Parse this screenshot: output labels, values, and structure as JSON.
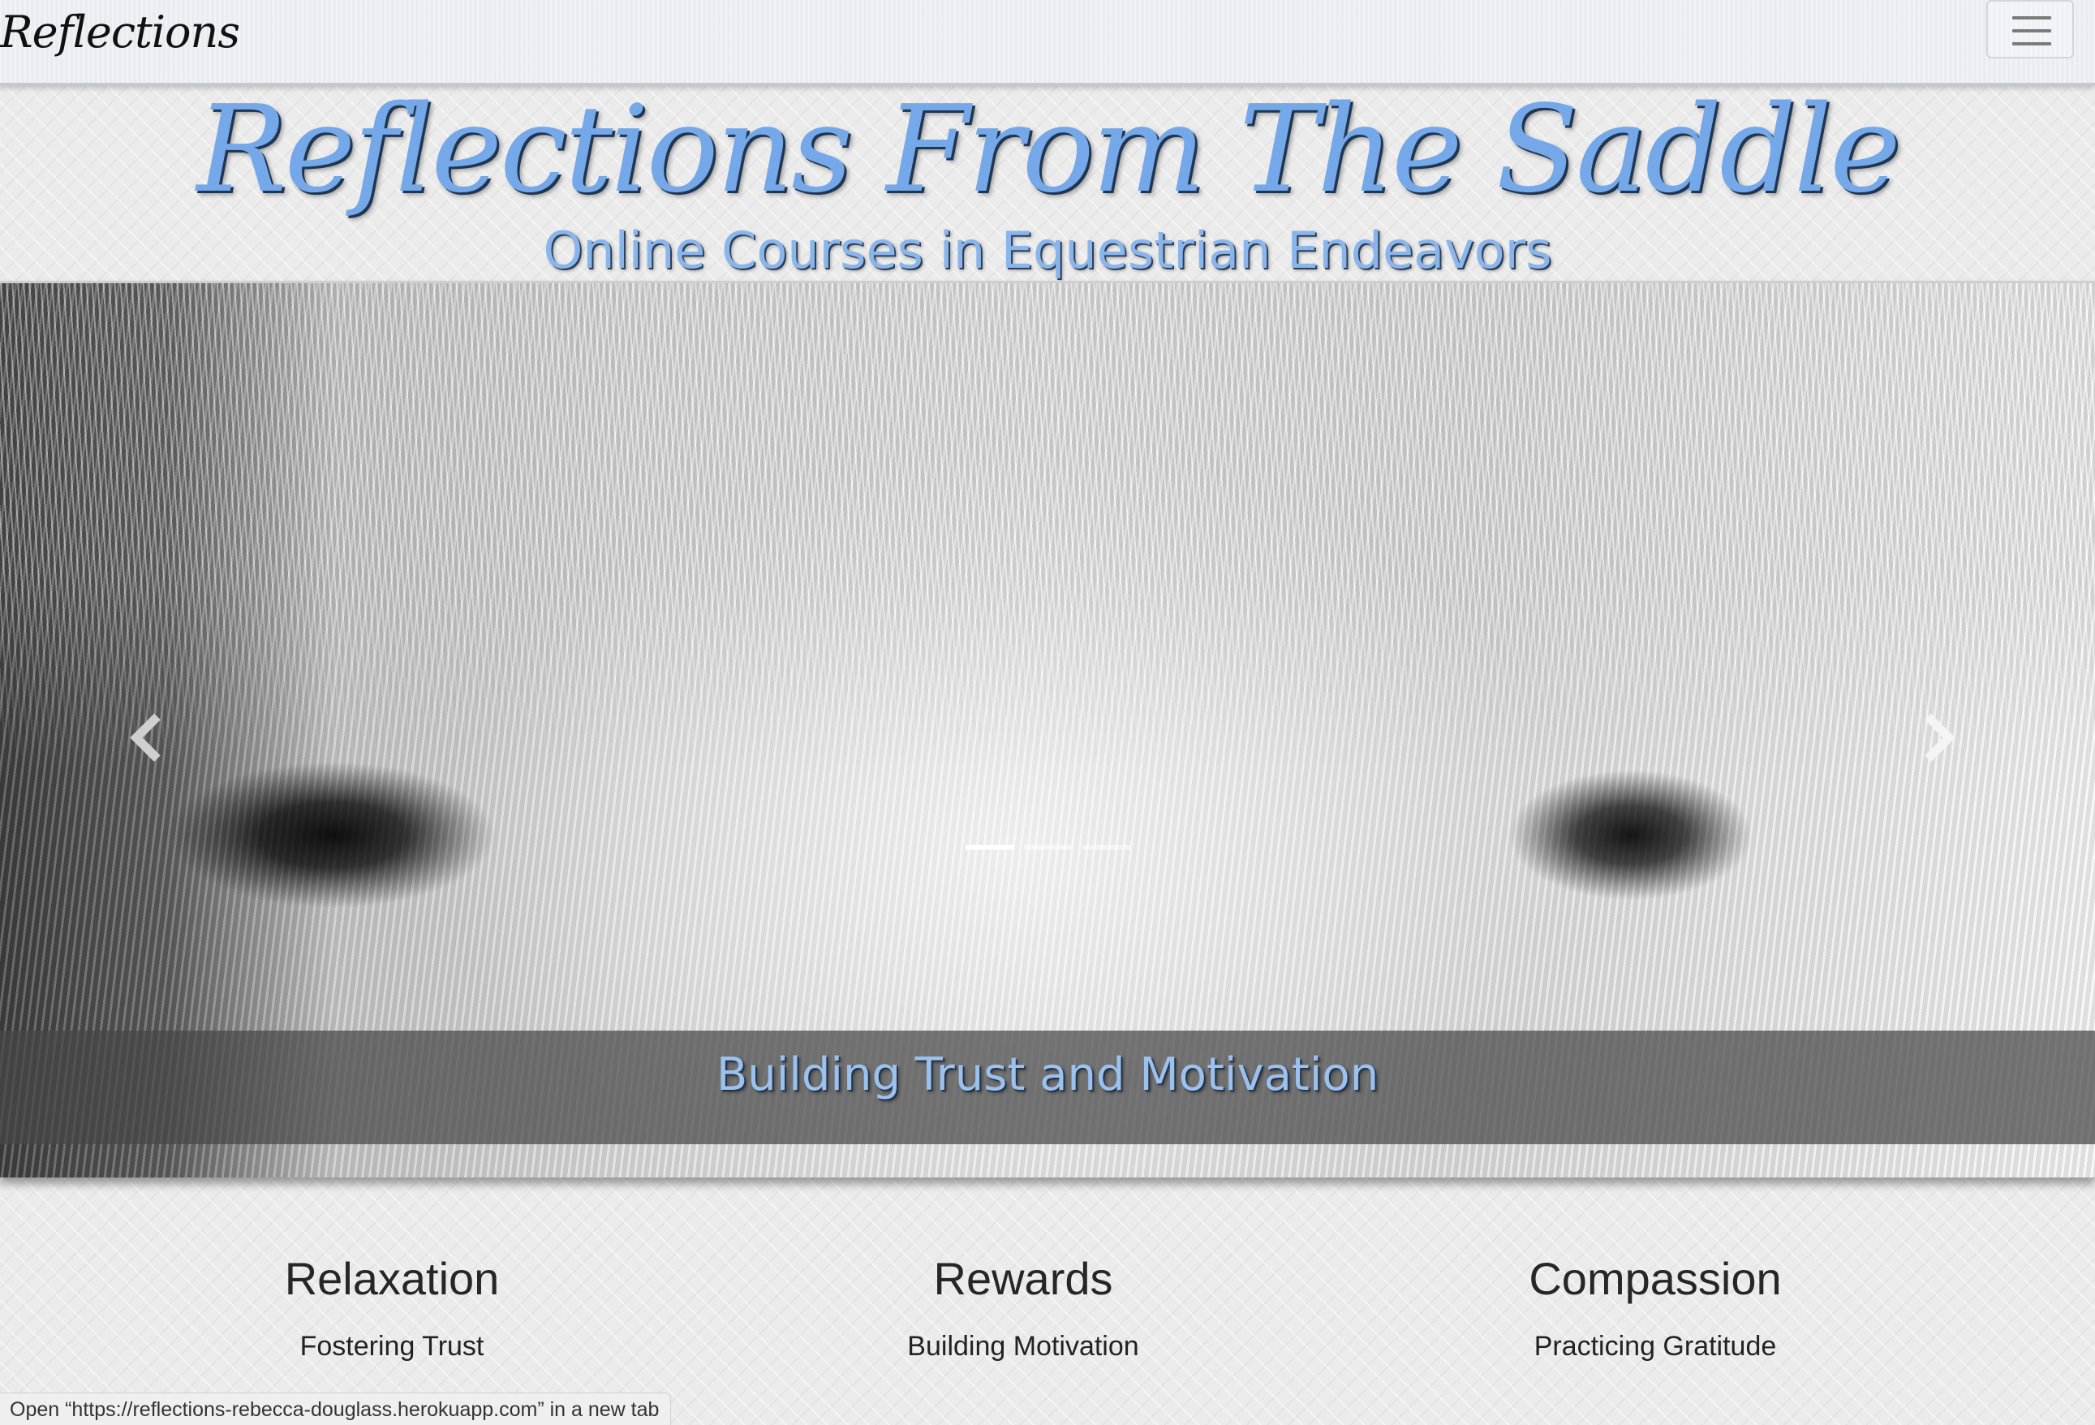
{
  "navbar": {
    "brand": "Reflections",
    "menu_icon": "hamburger-menu-icon"
  },
  "header": {
    "title": "Reflections From The Saddle",
    "subtitle": "Online Courses in Equestrian Endeavors"
  },
  "carousel": {
    "slide_caption": "Building Trust and Motivation",
    "prev_icon": "chevron-left-icon",
    "next_icon": "chevron-right-icon",
    "slide_count": 3,
    "active_index": 0
  },
  "features": [
    {
      "title": "Relaxation",
      "subtitle": "Fostering Trust"
    },
    {
      "title": "Rewards",
      "subtitle": "Building Motivation"
    },
    {
      "title": "Compassion",
      "subtitle": "Practicing Gratitude"
    }
  ],
  "status_bar": {
    "text": "Open “https://reflections-rebecca-douglass.herokuapp.com” in a new tab"
  },
  "colors": {
    "accent_blue": "#74a8e8",
    "navbar_bg": "#e9edf2",
    "caption_band": "#464646"
  }
}
